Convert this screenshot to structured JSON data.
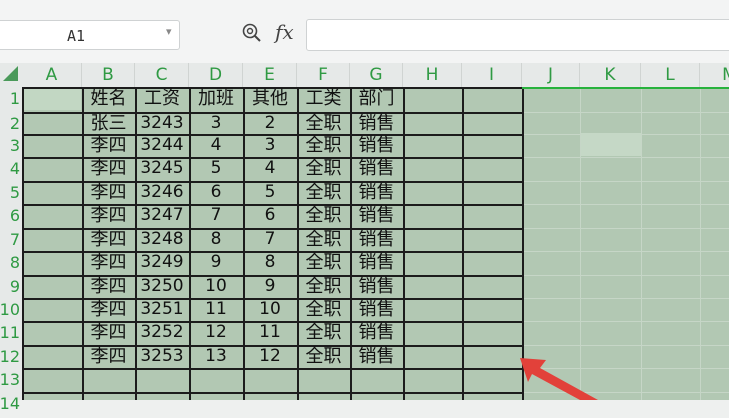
{
  "toolbar": {
    "namebox_value": "A1",
    "fx_label": "fx",
    "formula_value": ""
  },
  "columns": [
    "A",
    "B",
    "C",
    "D",
    "E",
    "F",
    "G",
    "H",
    "I",
    "J",
    "K",
    "L",
    "M"
  ],
  "rows": [
    "1",
    "2",
    "3",
    "4",
    "5",
    "6",
    "7",
    "8",
    "9",
    "10",
    "11",
    "12",
    "13",
    "14"
  ],
  "table": {
    "headers": [
      "姓名",
      "工资",
      "加班",
      "其他",
      "工类",
      "部门"
    ],
    "rows": [
      [
        "张三",
        "3243",
        "3",
        "2",
        "全职",
        "销售"
      ],
      [
        "李四",
        "3244",
        "4",
        "3",
        "全职",
        "销售"
      ],
      [
        "李四",
        "3245",
        "5",
        "4",
        "全职",
        "销售"
      ],
      [
        "李四",
        "3246",
        "6",
        "5",
        "全职",
        "销售"
      ],
      [
        "李四",
        "3247",
        "7",
        "6",
        "全职",
        "销售"
      ],
      [
        "李四",
        "3248",
        "8",
        "7",
        "全职",
        "销售"
      ],
      [
        "李四",
        "3249",
        "9",
        "8",
        "全职",
        "销售"
      ],
      [
        "李四",
        "3250",
        "10",
        "9",
        "全职",
        "销售"
      ],
      [
        "李四",
        "3251",
        "11",
        "10",
        "全职",
        "销售"
      ],
      [
        "李四",
        "3252",
        "12",
        "11",
        "全职",
        "销售"
      ],
      [
        "李四",
        "3253",
        "13",
        "12",
        "全职",
        "销售"
      ]
    ]
  },
  "colors": {
    "header_text": "#2f9a43",
    "selection_fill": "#b2c8b3",
    "selection_border": "#27b23c",
    "arrow": "#e2413a"
  }
}
